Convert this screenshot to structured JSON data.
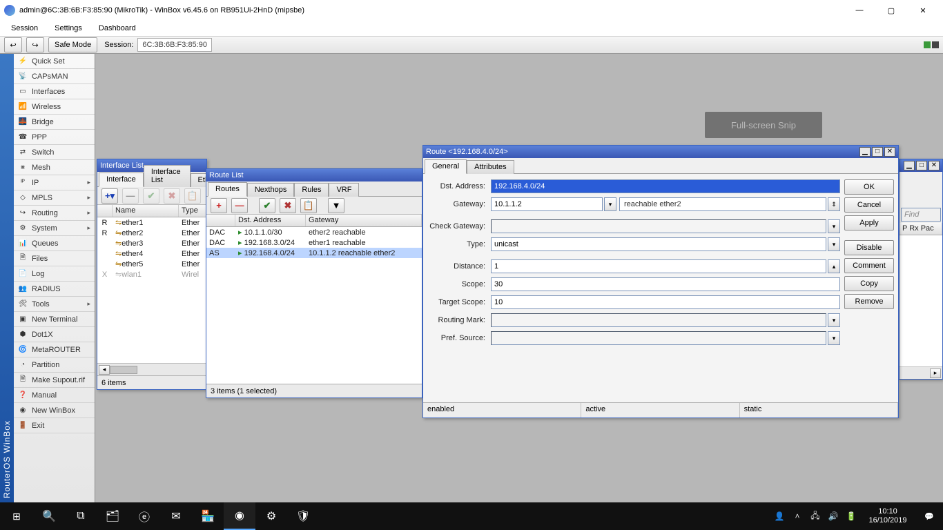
{
  "window": {
    "title": "admin@6C:3B:6B:F3:85:90 (MikroTik) - WinBox v6.45.6 on RB951Ui-2HnD (mipsbe)",
    "menu": {
      "session": "Session",
      "settings": "Settings",
      "dashboard": "Dashboard"
    },
    "safe_mode": "Safe Mode",
    "session_lbl": "Session:",
    "session_val": "6C:3B:6B:F3:85:90"
  },
  "branding": "RouterOS WinBox",
  "sidebar": [
    {
      "label": "Quick Set",
      "icon": "⚡",
      "arrow": false
    },
    {
      "label": "CAPsMAN",
      "icon": "📡",
      "arrow": false
    },
    {
      "label": "Interfaces",
      "icon": "▭",
      "arrow": false
    },
    {
      "label": "Wireless",
      "icon": "📶",
      "arrow": false
    },
    {
      "label": "Bridge",
      "icon": "🌉",
      "arrow": false
    },
    {
      "label": "PPP",
      "icon": "☎",
      "arrow": false
    },
    {
      "label": "Switch",
      "icon": "⇄",
      "arrow": false
    },
    {
      "label": "Mesh",
      "icon": "⨳",
      "arrow": false
    },
    {
      "label": "IP",
      "icon": "ᴵᴾ",
      "arrow": true
    },
    {
      "label": "MPLS",
      "icon": "◇",
      "arrow": true
    },
    {
      "label": "Routing",
      "icon": "↪",
      "arrow": true
    },
    {
      "label": "System",
      "icon": "⚙",
      "arrow": true
    },
    {
      "label": "Queues",
      "icon": "📊",
      "arrow": false
    },
    {
      "label": "Files",
      "icon": "🗎",
      "arrow": false
    },
    {
      "label": "Log",
      "icon": "📄",
      "arrow": false
    },
    {
      "label": "RADIUS",
      "icon": "👥",
      "arrow": false
    },
    {
      "label": "Tools",
      "icon": "🛠",
      "arrow": true
    },
    {
      "label": "New Terminal",
      "icon": "▣",
      "arrow": false
    },
    {
      "label": "Dot1X",
      "icon": "⬢",
      "arrow": false
    },
    {
      "label": "MetaROUTER",
      "icon": "🌀",
      "arrow": false
    },
    {
      "label": "Partition",
      "icon": "◔",
      "arrow": false
    },
    {
      "label": "Make Supout.rif",
      "icon": "🗎",
      "arrow": false
    },
    {
      "label": "Manual",
      "icon": "❓",
      "arrow": false
    },
    {
      "label": "New WinBox",
      "icon": "◉",
      "arrow": false
    },
    {
      "label": "Exit",
      "icon": "🚪",
      "arrow": false
    }
  ],
  "iflist": {
    "title": "Interface List",
    "tabs": [
      "Interface",
      "Interface List",
      "Ethe"
    ],
    "cols": {
      "name": "Name",
      "type": "Type"
    },
    "rows": [
      {
        "flag": "R",
        "name": "ether1",
        "type": "Ether"
      },
      {
        "flag": "R",
        "name": "ether2",
        "type": "Ether"
      },
      {
        "flag": "",
        "name": "ether3",
        "type": "Ether"
      },
      {
        "flag": "",
        "name": "ether4",
        "type": "Ether"
      },
      {
        "flag": "",
        "name": "ether5",
        "type": "Ether"
      },
      {
        "flag": "X",
        "name": "wlan1",
        "type": "Wirel"
      }
    ],
    "status": "6 items"
  },
  "routelist": {
    "title": "Route List",
    "tabs": [
      "Routes",
      "Nexthops",
      "Rules",
      "VRF"
    ],
    "cols": {
      "dst": "Dst. Address",
      "gw": "Gateway"
    },
    "rows": [
      {
        "flags": "DAC",
        "dst": "10.1.1.0/30",
        "gw": "ether2 reachable",
        "sel": false
      },
      {
        "flags": "DAC",
        "dst": "192.168.3.0/24",
        "gw": "ether1 reachable",
        "sel": false
      },
      {
        "flags": "AS",
        "dst": "192.168.4.0/24",
        "gw": "10.1.1.2 reachable ether2",
        "sel": true
      }
    ],
    "status": "3 items (1 selected)"
  },
  "routedlg": {
    "title": "Route <192.168.4.0/24>",
    "tabs": [
      "General",
      "Attributes"
    ],
    "labels": {
      "dst": "Dst. Address:",
      "gw": "Gateway:",
      "check": "Check Gateway:",
      "type": "Type:",
      "distance": "Distance:",
      "scope": "Scope:",
      "tscope": "Target Scope:",
      "rmark": "Routing Mark:",
      "psrc": "Pref. Source:"
    },
    "values": {
      "dst": "192.168.4.0/24",
      "gw": "10.1.1.2",
      "gw_status": "reachable ether2",
      "type": "unicast",
      "distance": "1",
      "scope": "30",
      "tscope": "10"
    },
    "buttons": {
      "ok": "OK",
      "cancel": "Cancel",
      "apply": "Apply",
      "disable": "Disable",
      "comment": "Comment",
      "copy": "Copy",
      "remove": "Remove"
    },
    "status": {
      "a": "enabled",
      "b": "active",
      "c": "static"
    }
  },
  "bg_window": {
    "find_placeholder": "Find",
    "col": "P Rx Pac"
  },
  "snip_label": "Full-screen Snip",
  "taskbar": {
    "time": "10:10",
    "date": "16/10/2019"
  }
}
